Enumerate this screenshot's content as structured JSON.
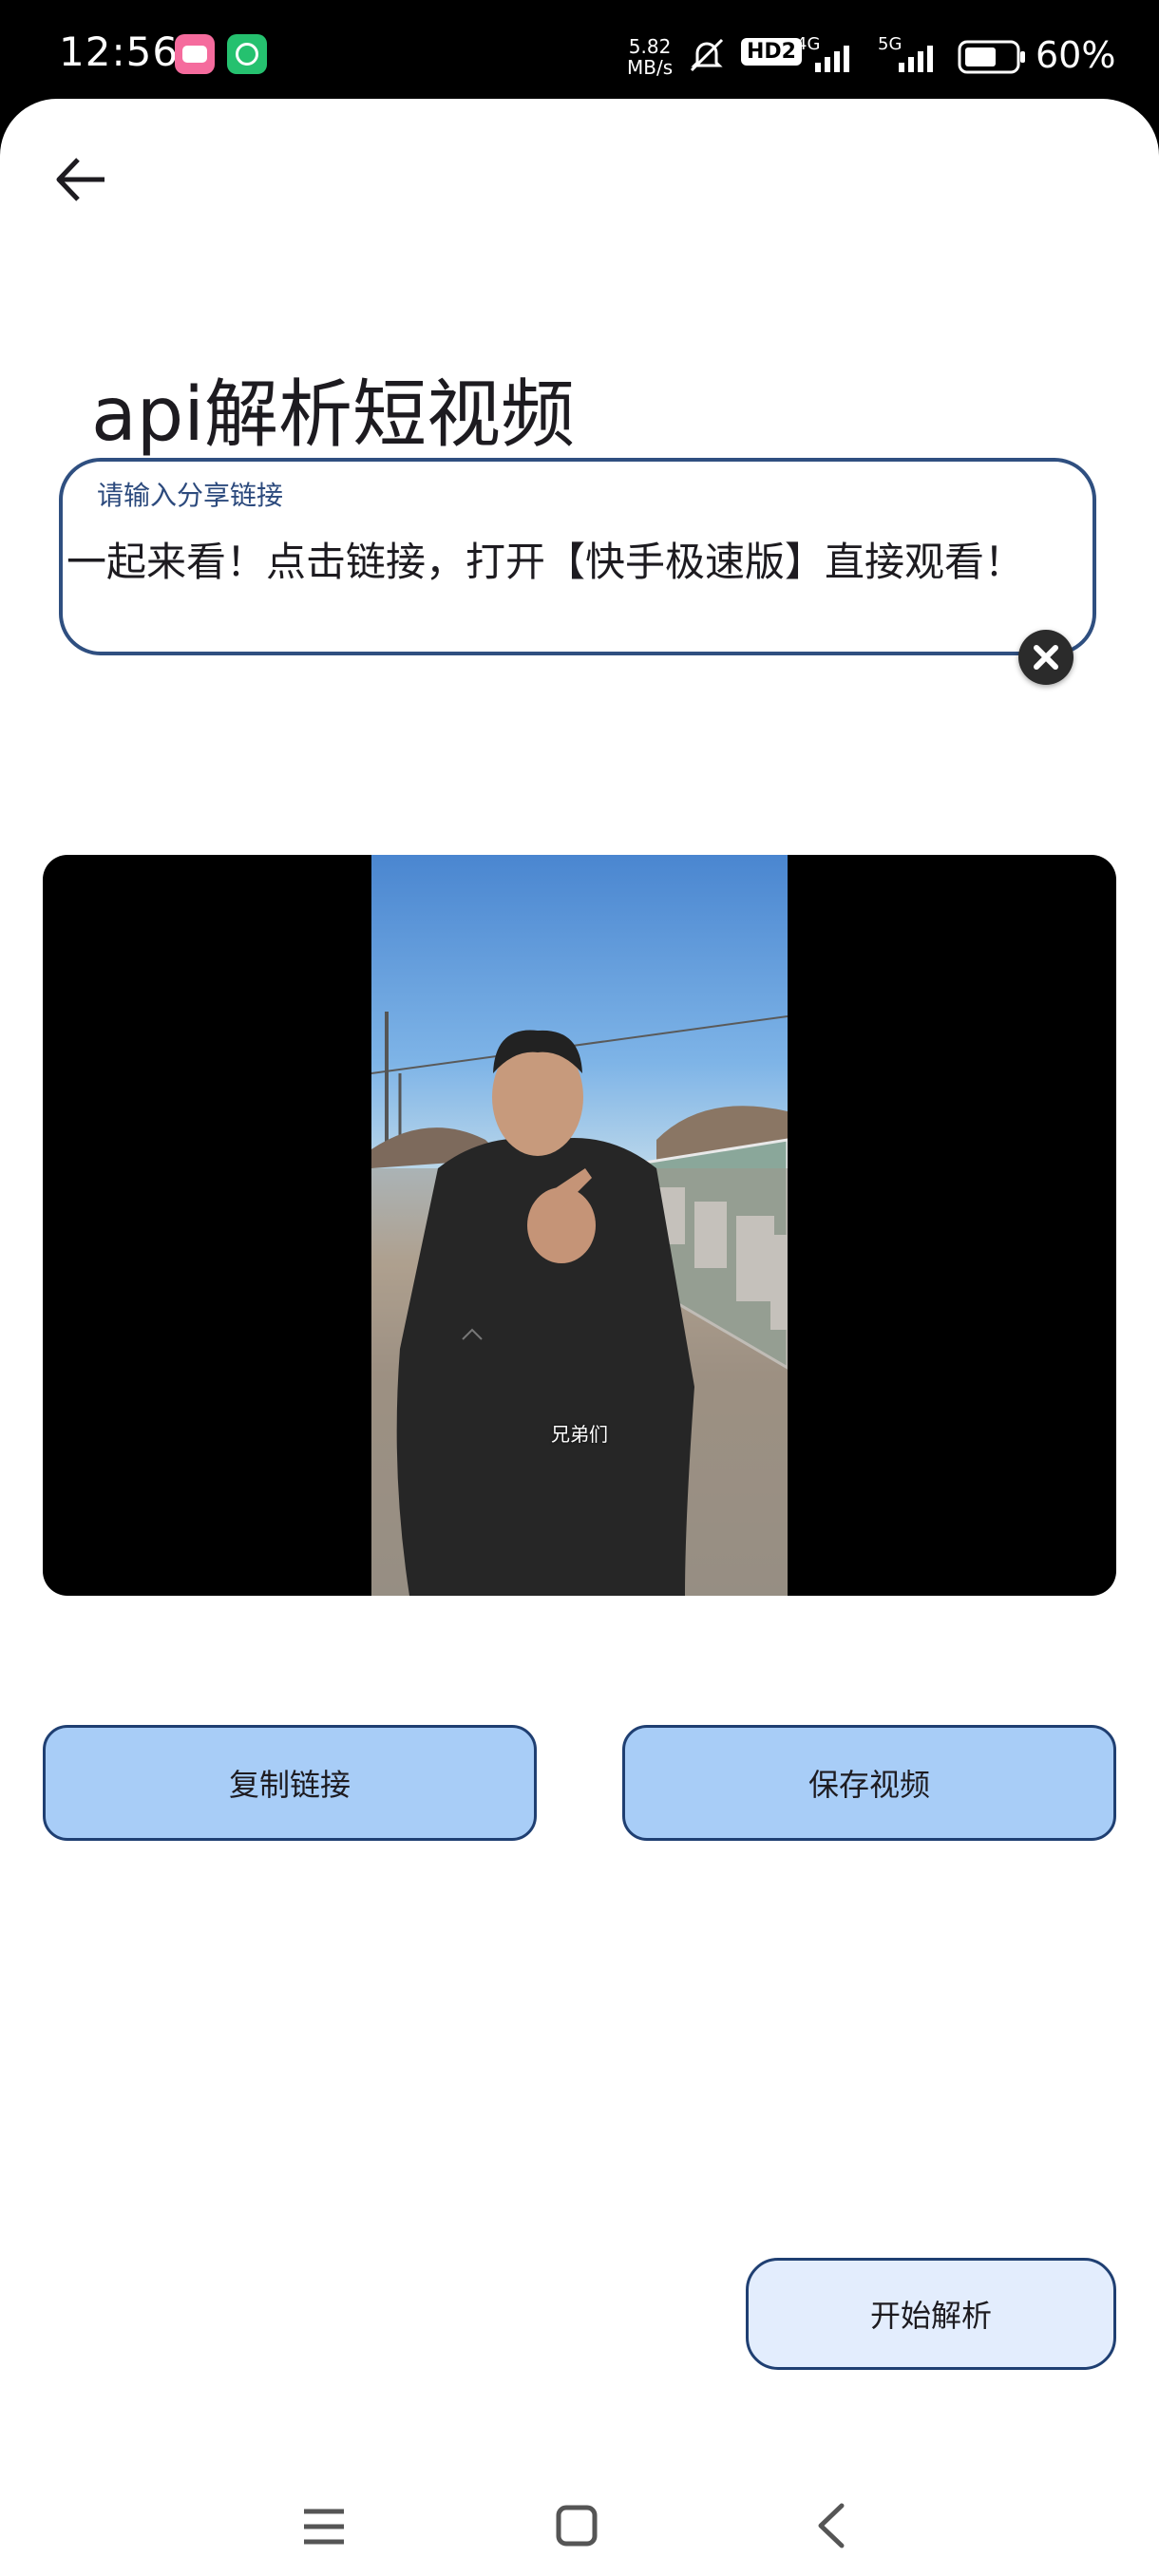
{
  "status_bar": {
    "time": "12:56",
    "net_speed_value": "5.82",
    "net_speed_unit": "MB/s",
    "hd_badge": "HD2",
    "network_1": "4G",
    "network_2": "5G",
    "battery_percent": "60%"
  },
  "header": {
    "back_icon": "arrow-left-icon",
    "title": "api解析短视频"
  },
  "url_input": {
    "label": "请输入分享链接",
    "value": "一起来看！点击链接，打开【快手极速版】直接观看！",
    "clear_icon": "close-circle-icon"
  },
  "video": {
    "subtitle": "兄弟们"
  },
  "actions": {
    "copy_link": "复制链接",
    "save_video": "保存视频",
    "start_parse": "开始解析"
  },
  "navigation": {
    "menu_icon": "menu-icon",
    "home_icon": "home-square-icon",
    "back_icon": "back-chevron-icon"
  },
  "colors": {
    "accent_border": "#1f3f72",
    "button_fill": "#a8cdf7",
    "start_button_fill": "#e3edfd"
  }
}
